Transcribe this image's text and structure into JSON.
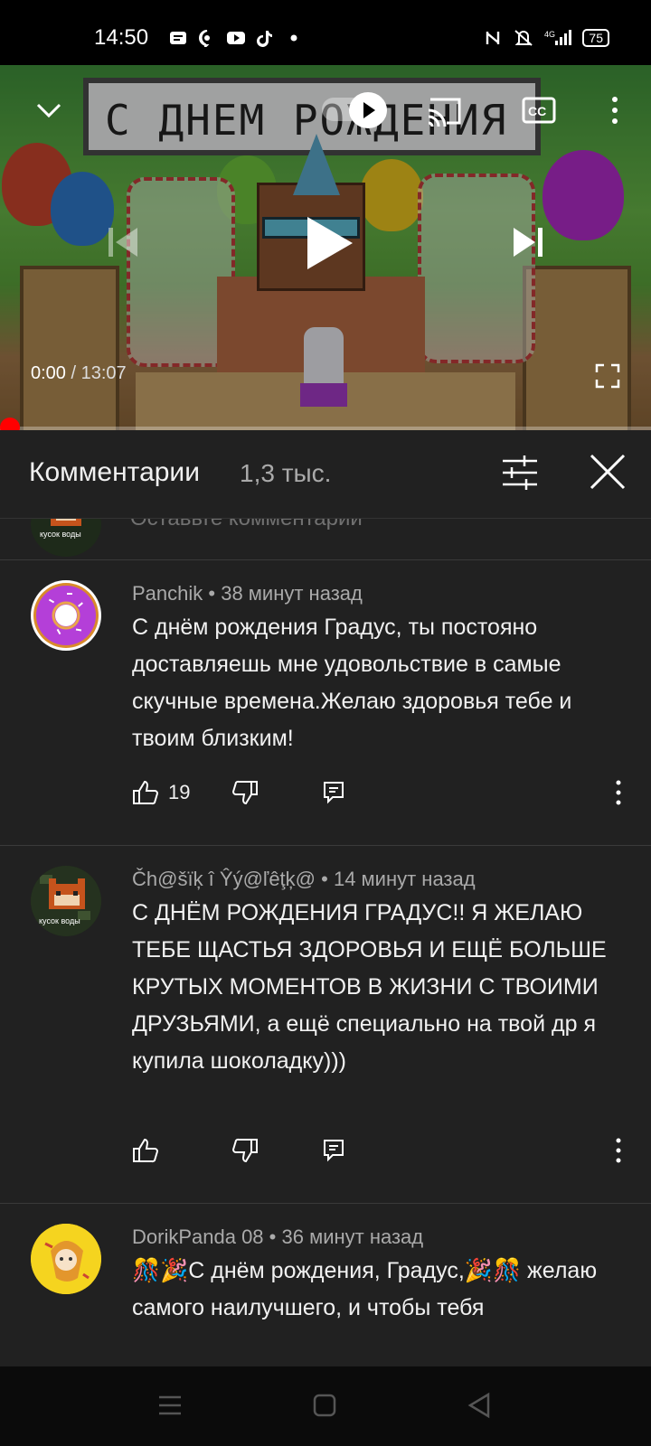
{
  "status_bar": {
    "time": "14:50",
    "battery": "75",
    "left_icons": [
      "message-icon",
      "viber-icon",
      "youtube-icon",
      "tiktok-icon",
      "dot-icon"
    ],
    "right_icons": [
      "nfc-icon",
      "mute-icon",
      "signal-4g-icon",
      "battery-icon"
    ]
  },
  "player": {
    "banner_text": "С ДНЕМ РОЖДЕНИЯ",
    "current_time": "0:00",
    "separator": " / ",
    "duration": "13:07",
    "progress": 0
  },
  "comments_header": {
    "title": "Комментарии",
    "count": "1,3 тыс."
  },
  "previous_comment": {
    "avatar_text": "кусок воды",
    "text": "Оставьте комментарий"
  },
  "comments": [
    {
      "author": "Panchik",
      "time": "38 минут назад",
      "text": "С днём рождения Градус, ты постояно доставляешь мне удовольствие в самые скучные времена.Желаю здоровья тебе и твоим близким!",
      "likes": "19",
      "avatar": "donut"
    },
    {
      "author": "Čh@šïķ î Ŷý@ľêţķ@",
      "time": "14 минут назад",
      "text": "С ДНЁМ РОЖДЕНИЯ ГРАДУС!!  Я ЖЕЛАЮ ТЕБЕ ЩАСТЬЯ ЗДОРОВЬЯ И ЕЩЁ БОЛЬШЕ КРУТЫХ МОМЕНТОВ В ЖИЗНИ С ТВОИМИ ДРУЗЬЯМИ, а ещё специально на твой др я купила шоколадку)))",
      "likes": "",
      "avatar": "fox",
      "avatar_text": "кусок воды"
    },
    {
      "author": "DorikPanda 08",
      "time": "36 минут назад",
      "text": "🎊🎉С днём рождения, Градус,🎉🎊 желаю самого наилучшего, и чтобы тебя",
      "likes": "",
      "avatar": "anime"
    }
  ],
  "meta_separator": " • ",
  "colors": {
    "background": "#212121",
    "text_primary": "#f1f1f1",
    "text_secondary": "#aaaaaa",
    "progress_red": "#ff0000"
  }
}
